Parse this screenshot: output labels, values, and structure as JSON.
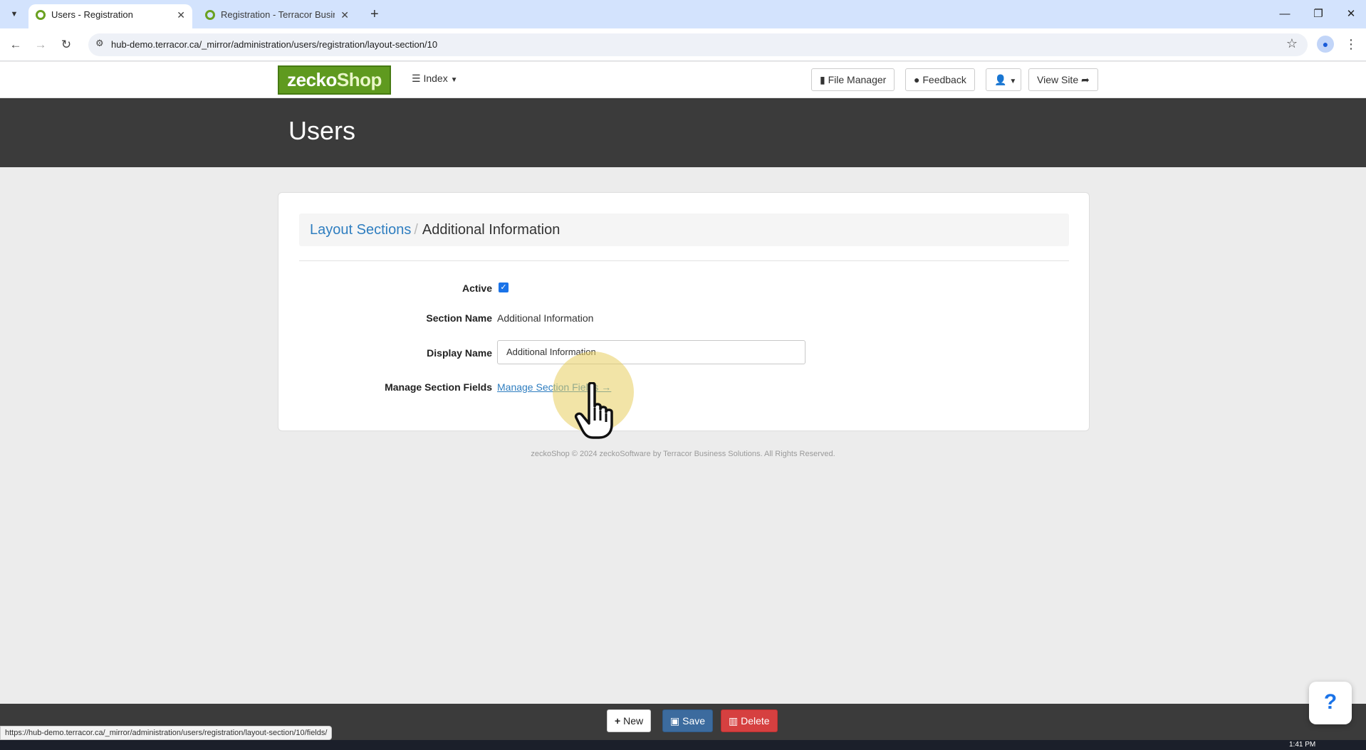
{
  "browser": {
    "tabs": [
      {
        "title": "Users - Registration",
        "active": true
      },
      {
        "title": "Registration - Terracor Business",
        "active": false
      }
    ],
    "new_tab": "+",
    "close": "✕",
    "url": "hub-demo.terracor.ca/_mirror/administration/users/registration/layout-section/10",
    "status_url": "https://hub-demo.terracor.ca/_mirror/administration/users/registration/layout-section/10/fields/"
  },
  "header": {
    "logo_zecko": "zecko",
    "logo_shop": "Shop",
    "index_label": "Index",
    "file_manager": "File Manager",
    "feedback": "Feedback",
    "view_site": "View Site"
  },
  "page": {
    "title": "Users"
  },
  "breadcrumb": {
    "parent": "Layout Sections",
    "separator": "/",
    "current": "Additional Information"
  },
  "form": {
    "active_label": "Active",
    "active_checked": true,
    "section_name_label": "Section Name",
    "section_name_value": "Additional Information",
    "display_name_label": "Display Name",
    "display_name_value": "Additional Information",
    "manage_fields_label": "Manage Section Fields",
    "manage_fields_link": "Manage Section Fields →"
  },
  "footer": {
    "copyright": "zeckoShop © 2024 zeckoSoftware by Terracor Business Solutions. All Rights Reserved."
  },
  "actions": {
    "new": "New",
    "save": "Save",
    "delete": "Delete"
  },
  "help": {
    "label": "?"
  },
  "taskbar": {
    "clock": "1:41 PM"
  },
  "colors": {
    "accent": "#2f7ec0",
    "brand_green": "#5f9a1f",
    "save": "#3c6b9e",
    "delete": "#d64040",
    "title_band": "#3b3b3b"
  }
}
